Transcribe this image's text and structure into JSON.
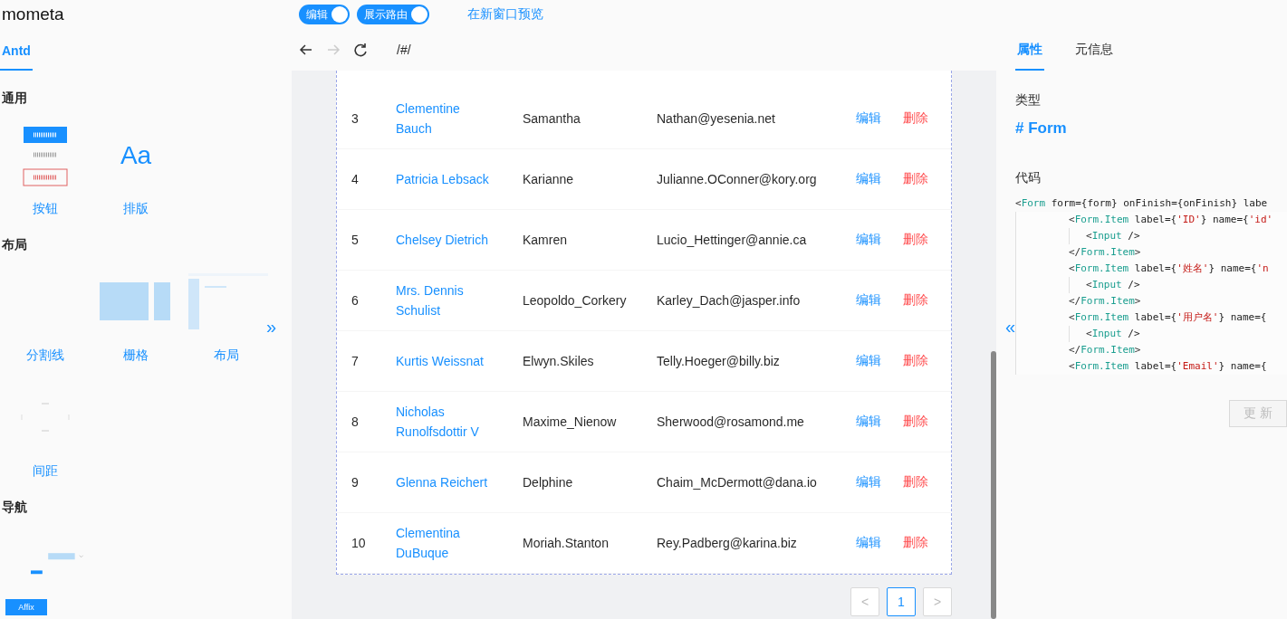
{
  "app": {
    "title": "mometa"
  },
  "toolbar": {
    "toggles": [
      {
        "label": "编辑",
        "on": true
      },
      {
        "label": "展示路由",
        "on": true
      }
    ],
    "link": "在新窗口预览"
  },
  "sidebar": {
    "tabs": [
      {
        "label": "Antd",
        "selected": true
      }
    ],
    "sections": [
      {
        "title": "通用",
        "items": [
          {
            "label": "按钮",
            "kind": "buttons"
          },
          {
            "label": "排版",
            "kind": "typography",
            "glyph": "Aa"
          }
        ]
      },
      {
        "title": "布局",
        "items": [
          {
            "label": "分割线",
            "kind": "divider"
          },
          {
            "label": "栅格",
            "kind": "grid"
          },
          {
            "label": "布局",
            "kind": "layout"
          },
          {
            "label": "间距",
            "kind": "space"
          }
        ],
        "more": "»"
      },
      {
        "title": "导航",
        "items": [
          {
            "kind": "nav"
          }
        ]
      }
    ],
    "affix": "Affix"
  },
  "browser": {
    "url": "/#/"
  },
  "table": {
    "rows": [
      {
        "id": "3",
        "name": "Clementine Bauch",
        "username": "Samantha",
        "email": "Nathan@yesenia.net",
        "edit": "编辑",
        "delete": "删除"
      },
      {
        "id": "4",
        "name": "Patricia Lebsack",
        "username": "Karianne",
        "email": "Julianne.OConner@kory.org",
        "edit": "编辑",
        "delete": "删除"
      },
      {
        "id": "5",
        "name": "Chelsey Dietrich",
        "username": "Kamren",
        "email": "Lucio_Hettinger@annie.ca",
        "edit": "编辑",
        "delete": "删除"
      },
      {
        "id": "6",
        "name": "Mrs. Dennis Schulist",
        "username": "Leopoldo_Corkery",
        "email": "Karley_Dach@jasper.info",
        "edit": "编辑",
        "delete": "删除"
      },
      {
        "id": "7",
        "name": "Kurtis Weissnat",
        "username": "Elwyn.Skiles",
        "email": "Telly.Hoeger@billy.biz",
        "edit": "编辑",
        "delete": "删除"
      },
      {
        "id": "8",
        "name": "Nicholas Runolfsdottir V",
        "username": "Maxime_Nienow",
        "email": "Sherwood@rosamond.me",
        "edit": "编辑",
        "delete": "删除"
      },
      {
        "id": "9",
        "name": "Glenna Reichert",
        "username": "Delphine",
        "email": "Chaim_McDermott@dana.io",
        "edit": "编辑",
        "delete": "删除"
      },
      {
        "id": "10",
        "name": "Clementina DuBuque",
        "username": "Moriah.Stanton",
        "email": "Rey.Padberg@karina.biz",
        "edit": "编辑",
        "delete": "删除"
      }
    ],
    "pagination": {
      "prev": "<",
      "next": ">",
      "pages": [
        {
          "label": "1",
          "selected": true
        }
      ]
    }
  },
  "panel": {
    "tabs": [
      {
        "label": "属性",
        "selected": true
      },
      {
        "label": "元信息",
        "selected": false
      }
    ],
    "type_label": "类型",
    "type_value": "# Form",
    "code_label": "代码",
    "code": [
      {
        "tokens": [
          {
            "kind": "punct",
            "text": "<"
          },
          {
            "kind": "tag",
            "text": "Form"
          },
          {
            "kind": "plain",
            "text": " form={form} onFinish={onFinish} labe"
          }
        ],
        "children": [
          {
            "tokens": [
              {
                "kind": "punct",
                "text": "<"
              },
              {
                "kind": "tag",
                "text": "Form.Item"
              },
              {
                "kind": "plain",
                "text": " label={"
              },
              {
                "kind": "string",
                "text": "'ID'"
              },
              {
                "kind": "plain",
                "text": "} name={"
              },
              {
                "kind": "string",
                "text": "'id'"
              }
            ],
            "children": [
              {
                "tokens": [
                  {
                    "kind": "punct",
                    "text": "<"
                  },
                  {
                    "kind": "tag",
                    "text": "Input"
                  },
                  {
                    "kind": "plain",
                    "text": " />"
                  }
                ]
              }
            ]
          },
          {
            "tokens": [
              {
                "kind": "punct",
                "text": "</"
              },
              {
                "kind": "tag",
                "text": "Form.Item"
              },
              {
                "kind": "punct",
                "text": ">"
              }
            ]
          },
          {
            "tokens": [
              {
                "kind": "punct",
                "text": "<"
              },
              {
                "kind": "tag",
                "text": "Form.Item"
              },
              {
                "kind": "plain",
                "text": " label={"
              },
              {
                "kind": "string",
                "text": "'姓名'"
              },
              {
                "kind": "plain",
                "text": "} name={"
              },
              {
                "kind": "string",
                "text": "'n"
              }
            ],
            "children": [
              {
                "tokens": [
                  {
                    "kind": "punct",
                    "text": "<"
                  },
                  {
                    "kind": "tag",
                    "text": "Input"
                  },
                  {
                    "kind": "plain",
                    "text": " />"
                  }
                ]
              }
            ]
          },
          {
            "tokens": [
              {
                "kind": "punct",
                "text": "</"
              },
              {
                "kind": "tag",
                "text": "Form.Item"
              },
              {
                "kind": "punct",
                "text": ">"
              }
            ]
          },
          {
            "tokens": [
              {
                "kind": "punct",
                "text": "<"
              },
              {
                "kind": "tag",
                "text": "Form.Item"
              },
              {
                "kind": "plain",
                "text": " label={"
              },
              {
                "kind": "string",
                "text": "'用户名'"
              },
              {
                "kind": "plain",
                "text": "} name={"
              }
            ],
            "children": [
              {
                "tokens": [
                  {
                    "kind": "punct",
                    "text": "<"
                  },
                  {
                    "kind": "tag",
                    "text": "Input"
                  },
                  {
                    "kind": "plain",
                    "text": " />"
                  }
                ]
              }
            ]
          },
          {
            "tokens": [
              {
                "kind": "punct",
                "text": "</"
              },
              {
                "kind": "tag",
                "text": "Form.Item"
              },
              {
                "kind": "punct",
                "text": ">"
              }
            ]
          },
          {
            "tokens": [
              {
                "kind": "punct",
                "text": "<"
              },
              {
                "kind": "tag",
                "text": "Form.Item"
              },
              {
                "kind": "plain",
                "text": " label={"
              },
              {
                "kind": "string",
                "text": "'Email'"
              },
              {
                "kind": "plain",
                "text": "} name={"
              }
            ]
          }
        ]
      }
    ],
    "collapse": "«",
    "update_button": {
      "label": "更 新",
      "disabled": true
    }
  }
}
